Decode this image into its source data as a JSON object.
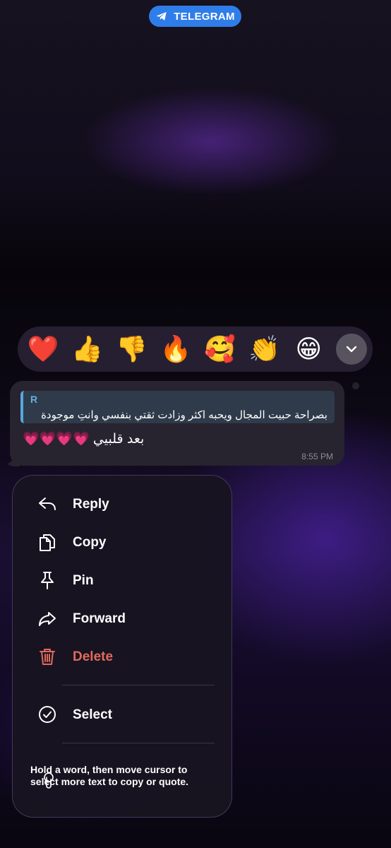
{
  "badge": {
    "label": "TELEGRAM",
    "icon": "telegram-plane-icon",
    "color": "#2f7de9"
  },
  "reactions": {
    "items": [
      {
        "emoji": "❤️",
        "name": "red-heart"
      },
      {
        "emoji": "👍",
        "name": "thumbs-up"
      },
      {
        "emoji": "👎",
        "name": "thumbs-down"
      },
      {
        "emoji": "🔥",
        "name": "fire"
      },
      {
        "emoji": "🥰",
        "name": "smiling-face-with-hearts"
      },
      {
        "emoji": "👏",
        "name": "clapping-hands"
      },
      {
        "emoji": "😁",
        "name": "beaming-face"
      }
    ],
    "expand_icon": "chevron-down-icon"
  },
  "message": {
    "reply_author": "R",
    "reply_text": "بصراحة حبيت المجال ويحبه اكثر وزادت ثقتي بنفسي وانتِ موجودة",
    "text": "بعد قلبيي 💗💗💗💗",
    "time": "8:55 PM"
  },
  "menu": {
    "reply": "Reply",
    "copy": "Copy",
    "pin": "Pin",
    "forward": "Forward",
    "delete": "Delete",
    "select": "Select",
    "hint": "Hold a word, then move cursor to select more text to copy or quote.",
    "delete_color": "#e26a5c"
  }
}
